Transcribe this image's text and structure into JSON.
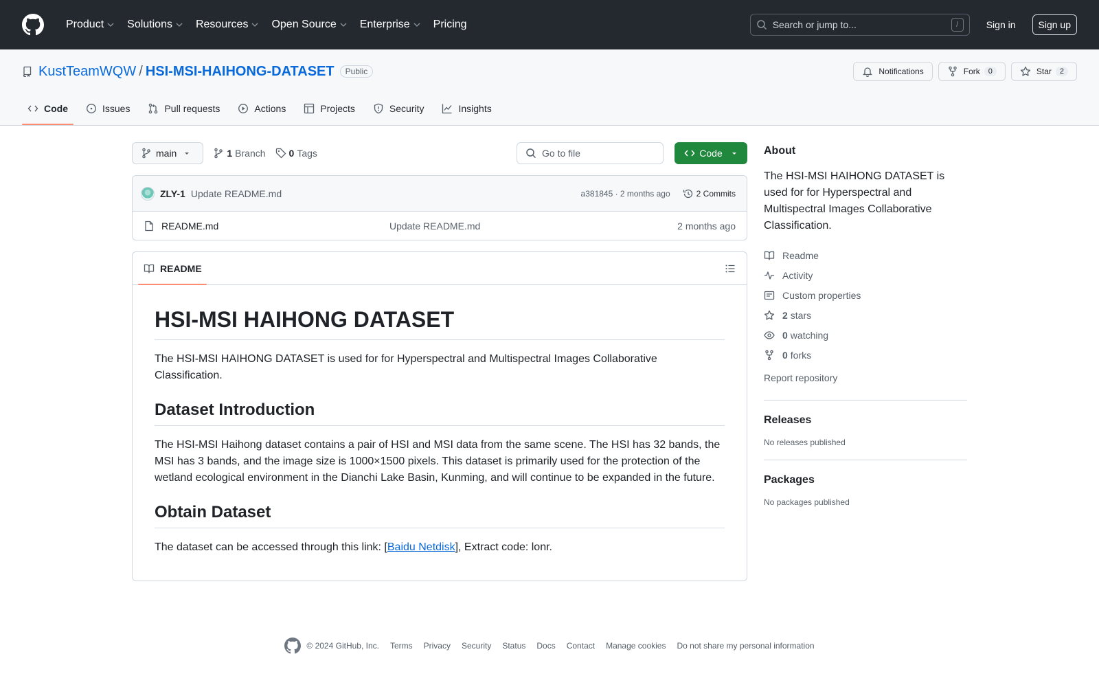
{
  "header": {
    "nav": [
      "Product",
      "Solutions",
      "Resources",
      "Open Source",
      "Enterprise",
      "Pricing"
    ],
    "search_placeholder": "Search or jump to...",
    "slash_key": "/",
    "sign_in": "Sign in",
    "sign_up": "Sign up"
  },
  "repo": {
    "owner": "KustTeamWQW",
    "slash": "/",
    "name": "HSI-MSI-HAIHONG-DATASET",
    "visibility": "Public",
    "notifications_label": "Notifications",
    "fork_label": "Fork",
    "fork_count": "0",
    "star_label": "Star",
    "star_count": "2"
  },
  "tabs": [
    "Code",
    "Issues",
    "Pull requests",
    "Actions",
    "Projects",
    "Security",
    "Insights"
  ],
  "file_nav": {
    "branch": "main",
    "branch_count": "1",
    "branch_label": "Branch",
    "tag_count": "0",
    "tag_label": "Tags",
    "goto_placeholder": "Go to file",
    "code_button": "Code"
  },
  "commit": {
    "author": "ZLY-1",
    "message": "Update README.md",
    "meta": "a381845 · 2 months ago",
    "commits_label": "2 Commits"
  },
  "files": [
    {
      "name": "README.md",
      "commit": "Update README.md",
      "age": "2 months ago"
    }
  ],
  "readme": {
    "tab_label": "README",
    "title": "HSI-MSI HAIHONG DATASET",
    "intro": "The HSI-MSI HAIHONG DATASET is used for for Hyperspectral and Multispectral Images Collaborative Classification.",
    "h2_intro": "Dataset Introduction",
    "intro_body": "The HSI-MSI Haihong dataset contains a pair of HSI and MSI data from the same scene. The HSI has 32 bands, the MSI has 3 bands, and the image size is 1000×1500 pixels. This dataset is primarily used for the protection of the wetland ecological environment in the Dianchi Lake Basin, Kunming, and will continue to be expanded in the future.",
    "h2_obtain": "Obtain Dataset",
    "obtain_prefix": "The dataset can be accessed through this link: [",
    "obtain_link": "Baidu Netdisk",
    "obtain_suffix": "], Extract code: lonr."
  },
  "about": {
    "heading": "About",
    "description": "The HSI-MSI HAIHONG DATASET is used for for Hyperspectral and Multispectral Images Collaborative Classification.",
    "readme": "Readme",
    "activity": "Activity",
    "custom_properties": "Custom properties",
    "stars_count": "2",
    "stars_label": "stars",
    "watching_count": "0",
    "watching_label": "watching",
    "forks_count": "0",
    "forks_label": "forks",
    "report": "Report repository"
  },
  "releases": {
    "heading": "Releases",
    "empty": "No releases published"
  },
  "packages": {
    "heading": "Packages",
    "empty": "No packages published"
  },
  "footer": {
    "copyright": "© 2024 GitHub, Inc.",
    "links": [
      "Terms",
      "Privacy",
      "Security",
      "Status",
      "Docs",
      "Contact",
      "Manage cookies",
      "Do not share my personal information"
    ]
  }
}
